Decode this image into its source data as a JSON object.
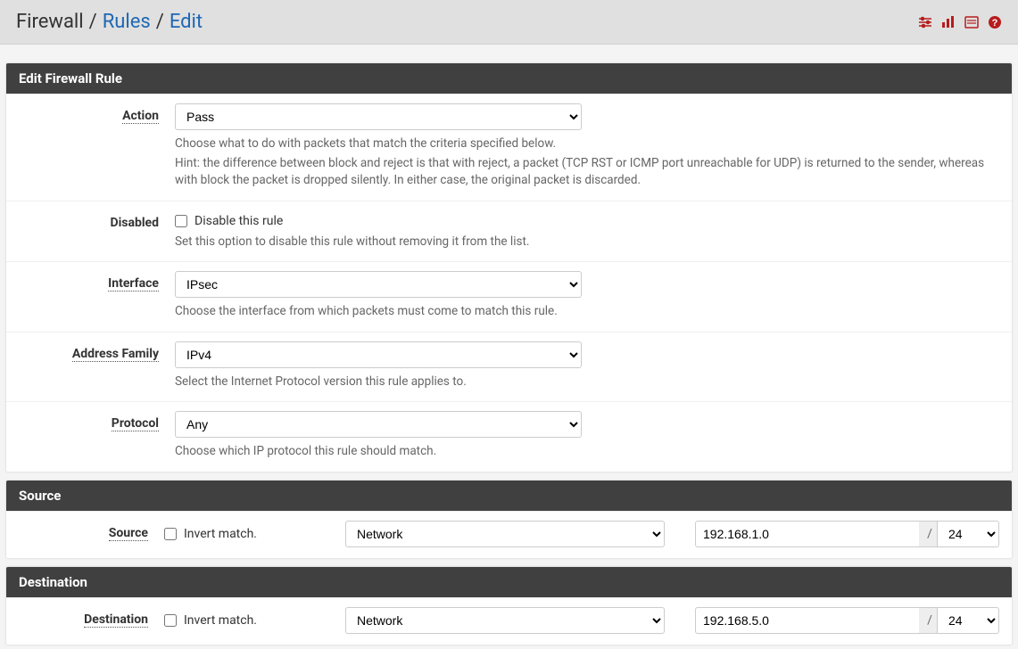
{
  "breadcrumb": {
    "root": "Firewall",
    "level1": "Rules",
    "level2": "Edit"
  },
  "icons": [
    "settings",
    "stats",
    "log",
    "help"
  ],
  "panels": {
    "edit": {
      "title": "Edit Firewall Rule",
      "action": {
        "label": "Action",
        "value": "Pass",
        "help1": "Choose what to do with packets that match the criteria specified below.",
        "help2": "Hint: the difference between block and reject is that with reject, a packet (TCP RST or ICMP port unreachable for UDP) is returned to the sender, whereas with block the packet is dropped silently. In either case, the original packet is discarded."
      },
      "disabled": {
        "label": "Disabled",
        "checkbox_label": "Disable this rule",
        "checked": false,
        "help": "Set this option to disable this rule without removing it from the list."
      },
      "interface": {
        "label": "Interface",
        "value": "IPsec",
        "help": "Choose the interface from which packets must come to match this rule."
      },
      "address_family": {
        "label": "Address Family",
        "value": "IPv4",
        "help": "Select the Internet Protocol version this rule applies to."
      },
      "protocol": {
        "label": "Protocol",
        "value": "Any",
        "help": "Choose which IP protocol this rule should match."
      }
    },
    "source": {
      "title": "Source",
      "label": "Source",
      "invert_label": "Invert match.",
      "invert_checked": false,
      "type": "Network",
      "address": "192.168.1.0",
      "mask": "24"
    },
    "destination": {
      "title": "Destination",
      "label": "Destination",
      "invert_label": "Invert match.",
      "invert_checked": false,
      "type": "Network",
      "address": "192.168.5.0",
      "mask": "24"
    }
  }
}
